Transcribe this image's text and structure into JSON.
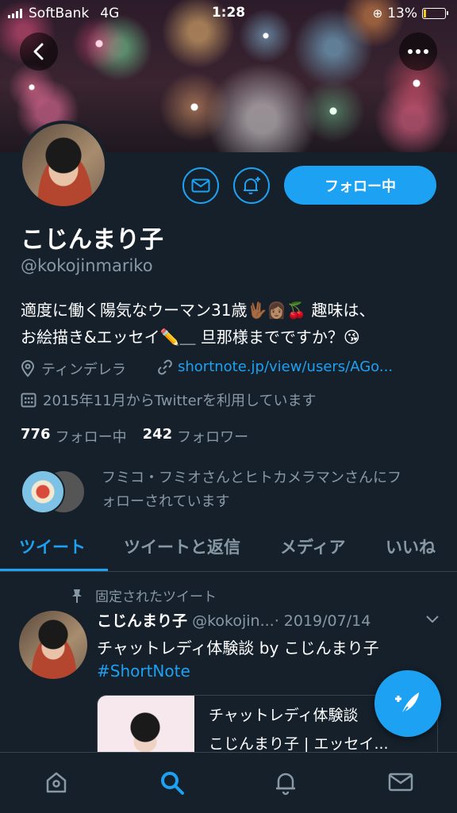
{
  "status_bar": {
    "carrier": "SoftBank",
    "network": "4G",
    "time": "1:28",
    "battery_pct": "13%",
    "battery_fraction": 0.13
  },
  "profile": {
    "name": "こじんまり子",
    "handle": "@kokojinmariko",
    "bio_line1": "適度に働く陽気なウーマン31歳🖖🏾👩🏽🍒 趣味は、",
    "bio_line2": "お絵描き&エッセイ✏️＿ 旦那様までですか？😘",
    "location": "ティンデレラ",
    "url": "shortnote.jp/view/users/AGo...",
    "joined": "2015年11月からTwitterを利用しています",
    "following_count": "776",
    "following_label": "フォロー中",
    "followers_count": "242",
    "followers_label": "フォロワー",
    "followed_by_line1": "フミコ・フミオさんとヒトカメラマンさんにフ",
    "followed_by_line2": "ォローされています",
    "follow_button": "フォロー中"
  },
  "tabs": [
    {
      "label": "ツイート",
      "active": true
    },
    {
      "label": "ツイートと返信",
      "active": false
    },
    {
      "label": "メディア",
      "active": false
    },
    {
      "label": "いいね",
      "active": false
    }
  ],
  "pinned_tweet": {
    "pinned_label": "固定されたツイート",
    "name": "こじんまり子",
    "handle": "@kokojin...",
    "date": "· 2019/07/14",
    "text": "チャットレディ体験談 by こじんまり子",
    "hashtag": "#ShortNote",
    "card_title": "チャットレディ体験談",
    "card_subtitle": "こじんまり子 | エッセイ..."
  },
  "icons": {
    "back": "back-arrow-icon",
    "more": "more-icon",
    "message": "envelope-icon",
    "notify": "bell-plus-icon",
    "location": "location-pin-icon",
    "link": "link-icon",
    "calendar": "calendar-icon",
    "pin": "pin-icon",
    "compose": "compose-feather-icon",
    "home": "home-icon",
    "search": "search-icon",
    "notifications": "bell-icon",
    "messages": "mail-icon"
  },
  "colors": {
    "accent": "#1da1f2",
    "background": "#15202b",
    "muted": "#8899a6",
    "divider": "#38444d",
    "battery": "#f4c724"
  }
}
